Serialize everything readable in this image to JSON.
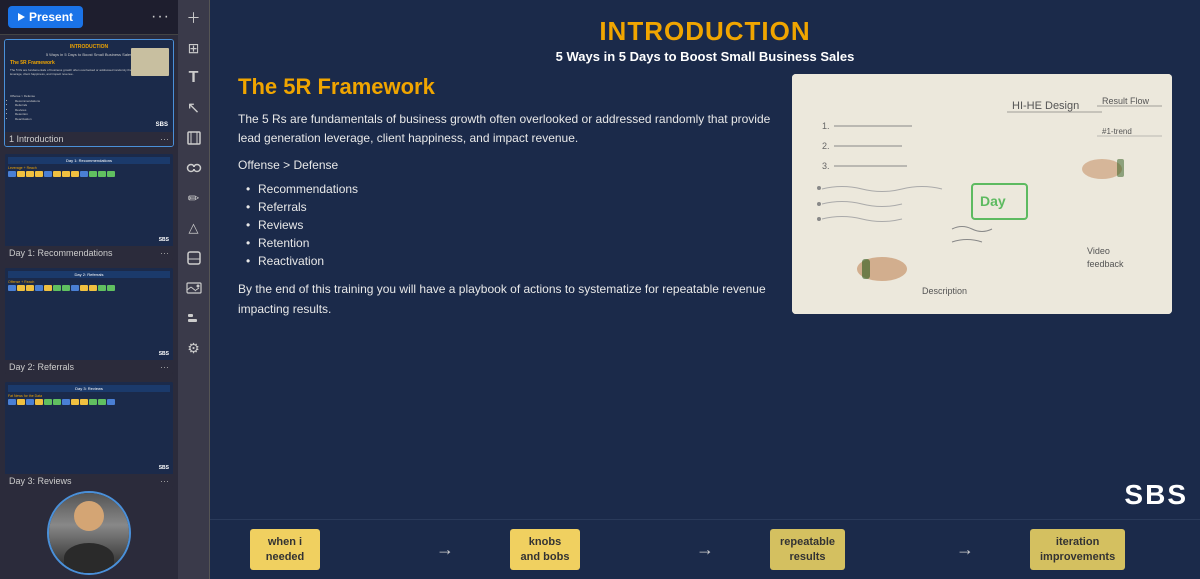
{
  "sidebar": {
    "present_label": "Present",
    "slides": [
      {
        "id": 1,
        "label": "Introduction",
        "active": true,
        "title": "INTRODUCTION",
        "subtitle": "5 Ways in 5 Days to Boost Small Business Sales"
      },
      {
        "id": 2,
        "label": "Day 1: Recommendations"
      },
      {
        "id": 3,
        "label": "Day 2: Referrals"
      },
      {
        "id": 4,
        "label": "Day 3: Reviews"
      }
    ]
  },
  "toolbar": {
    "tools": [
      {
        "name": "add-slide-icon",
        "glyph": "+"
      },
      {
        "name": "grid-view-icon",
        "glyph": "⊞"
      },
      {
        "name": "text-tool-icon",
        "glyph": "T"
      },
      {
        "name": "pointer-tool-icon",
        "glyph": "↖"
      },
      {
        "name": "crop-tool-icon",
        "glyph": "⊡"
      },
      {
        "name": "link-tool-icon",
        "glyph": "⌖"
      },
      {
        "name": "pen-tool-icon",
        "glyph": "✏"
      },
      {
        "name": "shape-tool-icon",
        "glyph": "△"
      },
      {
        "name": "eraser-tool-icon",
        "glyph": "✕"
      },
      {
        "name": "image-tool-icon",
        "glyph": "⊞"
      },
      {
        "name": "align-tool-icon",
        "glyph": "⊟"
      },
      {
        "name": "settings-tool-icon",
        "glyph": "❋"
      }
    ]
  },
  "slide": {
    "main_title": "INTRODUCTION",
    "subtitle": "5 Ways in 5 Days to Boost Small Business Sales",
    "framework_title": "The 5R Framework",
    "framework_desc": "The 5 Rs are fundamentals of business growth often overlooked or addressed randomly that provide lead generation leverage, client happiness, and impact revenue.",
    "offense_text": "Offense > Defense",
    "bullets": [
      "Recommendations",
      "Referrals",
      "Reviews",
      "Retention",
      "Reactivation"
    ],
    "cta_text": "By the end of this training you will have a playbook of actions to systematize for repeatable revenue impacting results.",
    "sbs_logo": "SBS"
  },
  "progress": {
    "steps": [
      {
        "label": "when i\nneeded",
        "highlight": true
      },
      {
        "label": "knobs\nand bobs",
        "highlight": true
      },
      {
        "label": "repeatable\nresults",
        "highlight": false
      },
      {
        "label": "iteration\nimprovements",
        "highlight": false
      }
    ]
  }
}
